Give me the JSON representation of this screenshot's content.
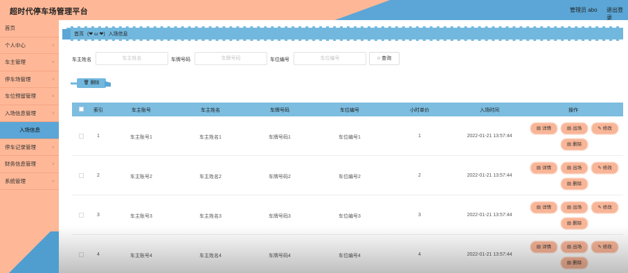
{
  "header": {
    "title": "超时代停车场管理平台",
    "admin": "管理员 abo",
    "logout": "退出登录"
  },
  "sidebar": {
    "items": [
      {
        "label": "首页",
        "chevron": false
      },
      {
        "label": "个人中心",
        "chevron": true
      },
      {
        "label": "车主管理",
        "chevron": true
      },
      {
        "label": "停车场管理",
        "chevron": true
      },
      {
        "label": "车位预留管理",
        "chevron": true
      },
      {
        "label": "入场信息管理",
        "chevron": true
      },
      {
        "label": "入场信息",
        "chevron": false,
        "sub": true
      },
      {
        "label": "停车记录管理",
        "chevron": true
      },
      {
        "label": "财务信息管理",
        "chevron": true
      },
      {
        "label": "系统管理",
        "chevron": true
      }
    ]
  },
  "breadcrumb": {
    "home": "首页",
    "emoji": "(❤ ω ❤)",
    "current": "入场信息"
  },
  "search": {
    "owner_name_label": "车主姓名",
    "owner_name_placeholder": "车主姓名",
    "plate_label": "车牌号码",
    "plate_placeholder": "车牌号码",
    "spot_label": "车位编号",
    "spot_placeholder": "车位编号",
    "search_button": "查询"
  },
  "toolbar": {
    "delete_button": "删除"
  },
  "table": {
    "columns": [
      "索引",
      "车主账号",
      "车主姓名",
      "车牌号码",
      "车位编号",
      "小时单价",
      "入场时间",
      "操作"
    ],
    "rows": [
      {
        "index": "1",
        "account": "车主账号1",
        "name": "车主姓名1",
        "plate": "车牌号码1",
        "spot": "车位编号1",
        "price": "1",
        "time": "2022-01-21 13:57:44"
      },
      {
        "index": "2",
        "account": "车主账号2",
        "name": "车主姓名2",
        "plate": "车牌号码2",
        "spot": "车位编号2",
        "price": "2",
        "time": "2022-01-21 13:57:44"
      },
      {
        "index": "3",
        "account": "车主账号3",
        "name": "车主姓名3",
        "plate": "车牌号码3",
        "spot": "车位编号3",
        "price": "3",
        "time": "2022-01-21 13:57:44"
      },
      {
        "index": "4",
        "account": "车主账号4",
        "name": "车主姓名4",
        "plate": "车牌号码4",
        "spot": "车位编号4",
        "price": "4",
        "time": "2022-01-21 13:57:44"
      }
    ],
    "actions": {
      "detail": "详情",
      "exit": "出场",
      "edit": "修改",
      "delete": "删除"
    }
  },
  "colors": {
    "header_peach": "#ffb897",
    "accent_blue": "#5ba6d6",
    "table_header": "#7cbde0",
    "action_button": "#f8b597"
  }
}
